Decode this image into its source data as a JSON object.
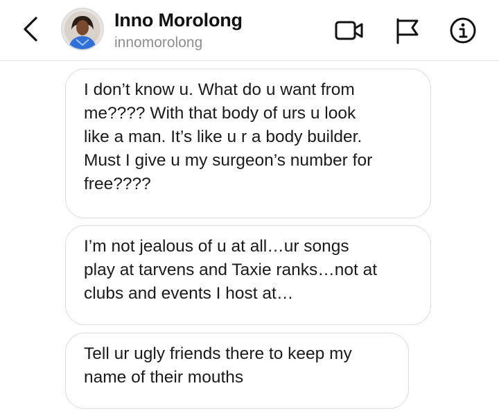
{
  "header": {
    "back_icon": "chevron-left-icon",
    "contact_name": "Inno Morolong",
    "contact_handle": "innomorolong",
    "avatar_icon": "profile-photo",
    "actions": [
      {
        "icon": "video-call-icon"
      },
      {
        "icon": "flag-icon"
      },
      {
        "icon": "info-icon"
      }
    ]
  },
  "messages": [
    {
      "text": "I don’t know u. What do u want from\nme???? With that body of urs u look\nlike a man. It’s like u r a body builder.\nMust I give u my surgeon’s number for\nfree????"
    },
    {
      "text": "I’m not jealous of u at all…ur songs\nplay at tarvens and Taxie ranks…not at\nclubs and events I host at…"
    },
    {
      "text": "Tell ur ugly friends there to keep my\nname of their mouths"
    }
  ],
  "colors": {
    "bubble_border": "#dbdbdb",
    "handle_text": "#8e8e8e",
    "avatar_outfit": "#2f6fd6"
  }
}
